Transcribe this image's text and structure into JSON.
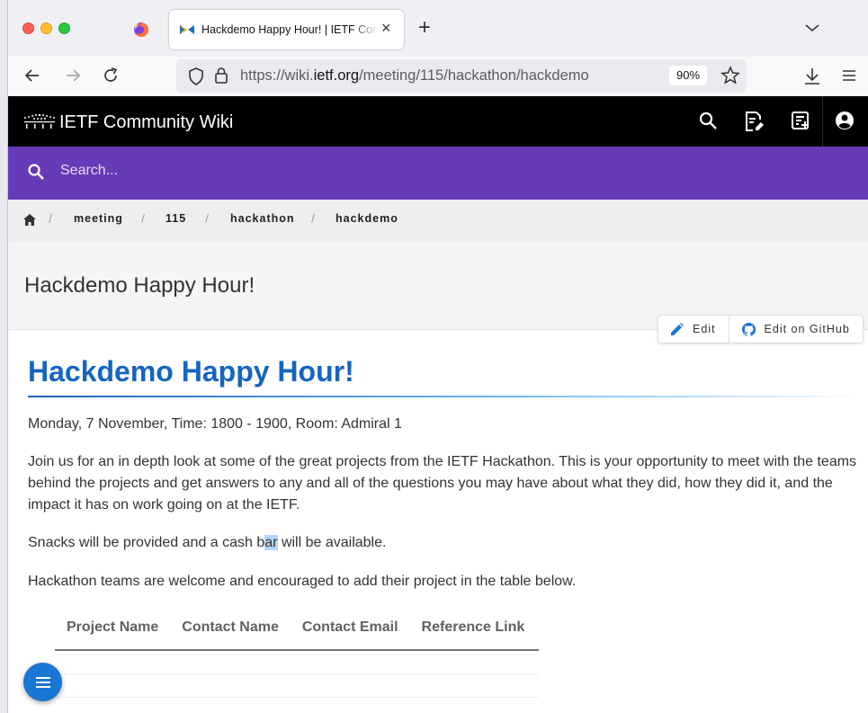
{
  "browser": {
    "tab_title": "Hackdemo Happy Hour! | IETF Community Wiki",
    "url_prefix": "https://wiki.",
    "url_domain": "ietf.org",
    "url_path": "/meeting/115/hackathon/hackdemo",
    "zoom": "90%"
  },
  "site": {
    "title": "IETF Community Wiki",
    "search_placeholder": "Search..."
  },
  "breadcrumb": [
    "meeting",
    "115",
    "hackathon",
    "hackdemo"
  ],
  "page": {
    "title": "Hackdemo Happy Hour!",
    "edit_label": "Edit",
    "edit_github_label": "Edit on GitHub"
  },
  "article": {
    "heading": "Hackdemo Happy Hour!",
    "schedule": "Monday, 7 November, Time: 1800 - 1900, Room: Admiral 1",
    "intro": "Join us for an in depth look at some of the great projects from the IETF Hackathon. This is your opportunity to meet with the teams behind the projects and get answers to any and all of the questions you may have about what they did, how they did it, and the impact it has on work going on at the IETF.",
    "snacks_before": "Snacks will be provided and a cash b",
    "snacks_selected": "ar",
    "snacks_after": " will be available.",
    "teams": "Hackathon teams are welcome and encouraged to add their project in the table below.",
    "table_headers": [
      "Project Name",
      "Contact Name",
      "Contact Email",
      "Reference Link"
    ]
  },
  "colors": {
    "header_bg": "#000000",
    "search_bg": "#673ab7",
    "heading": "#1565c0",
    "fab": "#1976d2"
  }
}
